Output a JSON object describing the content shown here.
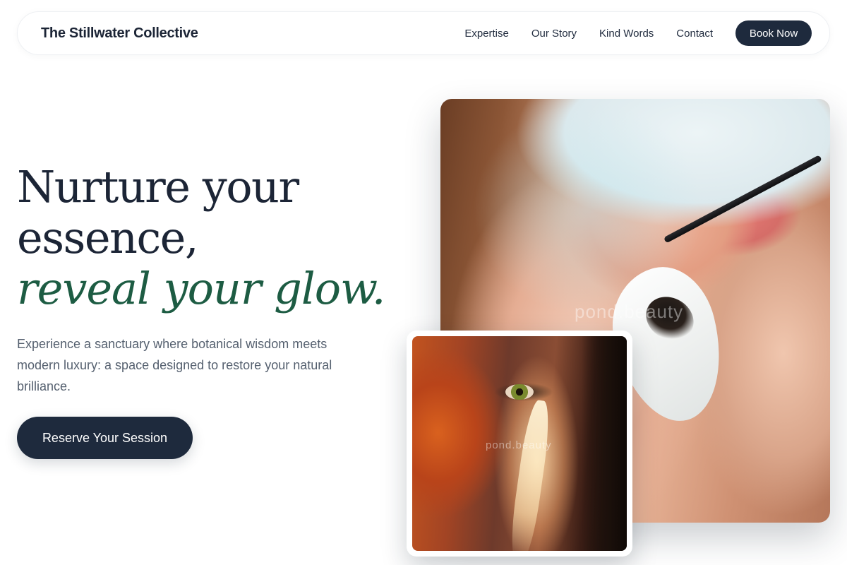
{
  "brand": {
    "name": "The Stillwater Collective"
  },
  "nav": {
    "links": [
      {
        "label": "Expertise"
      },
      {
        "label": "Our Story"
      },
      {
        "label": "Kind Words"
      },
      {
        "label": "Contact"
      }
    ],
    "cta_label": "Book Now"
  },
  "hero": {
    "headline_lines": [
      "Nurture your",
      "essence,",
      "reveal your glow."
    ],
    "subtitle": "Experience a sanctuary where botanical wisdom meets modern luxury: a space designed to restore your natural brilliance.",
    "cta_label": "Reserve Your Session"
  },
  "images": {
    "main_watermark": "pond.beauty",
    "inset_watermark": "pond.beauty"
  },
  "colors": {
    "navy": "#1e2a3d",
    "accent_green": "#1d5c43",
    "body_text": "#55606f"
  }
}
